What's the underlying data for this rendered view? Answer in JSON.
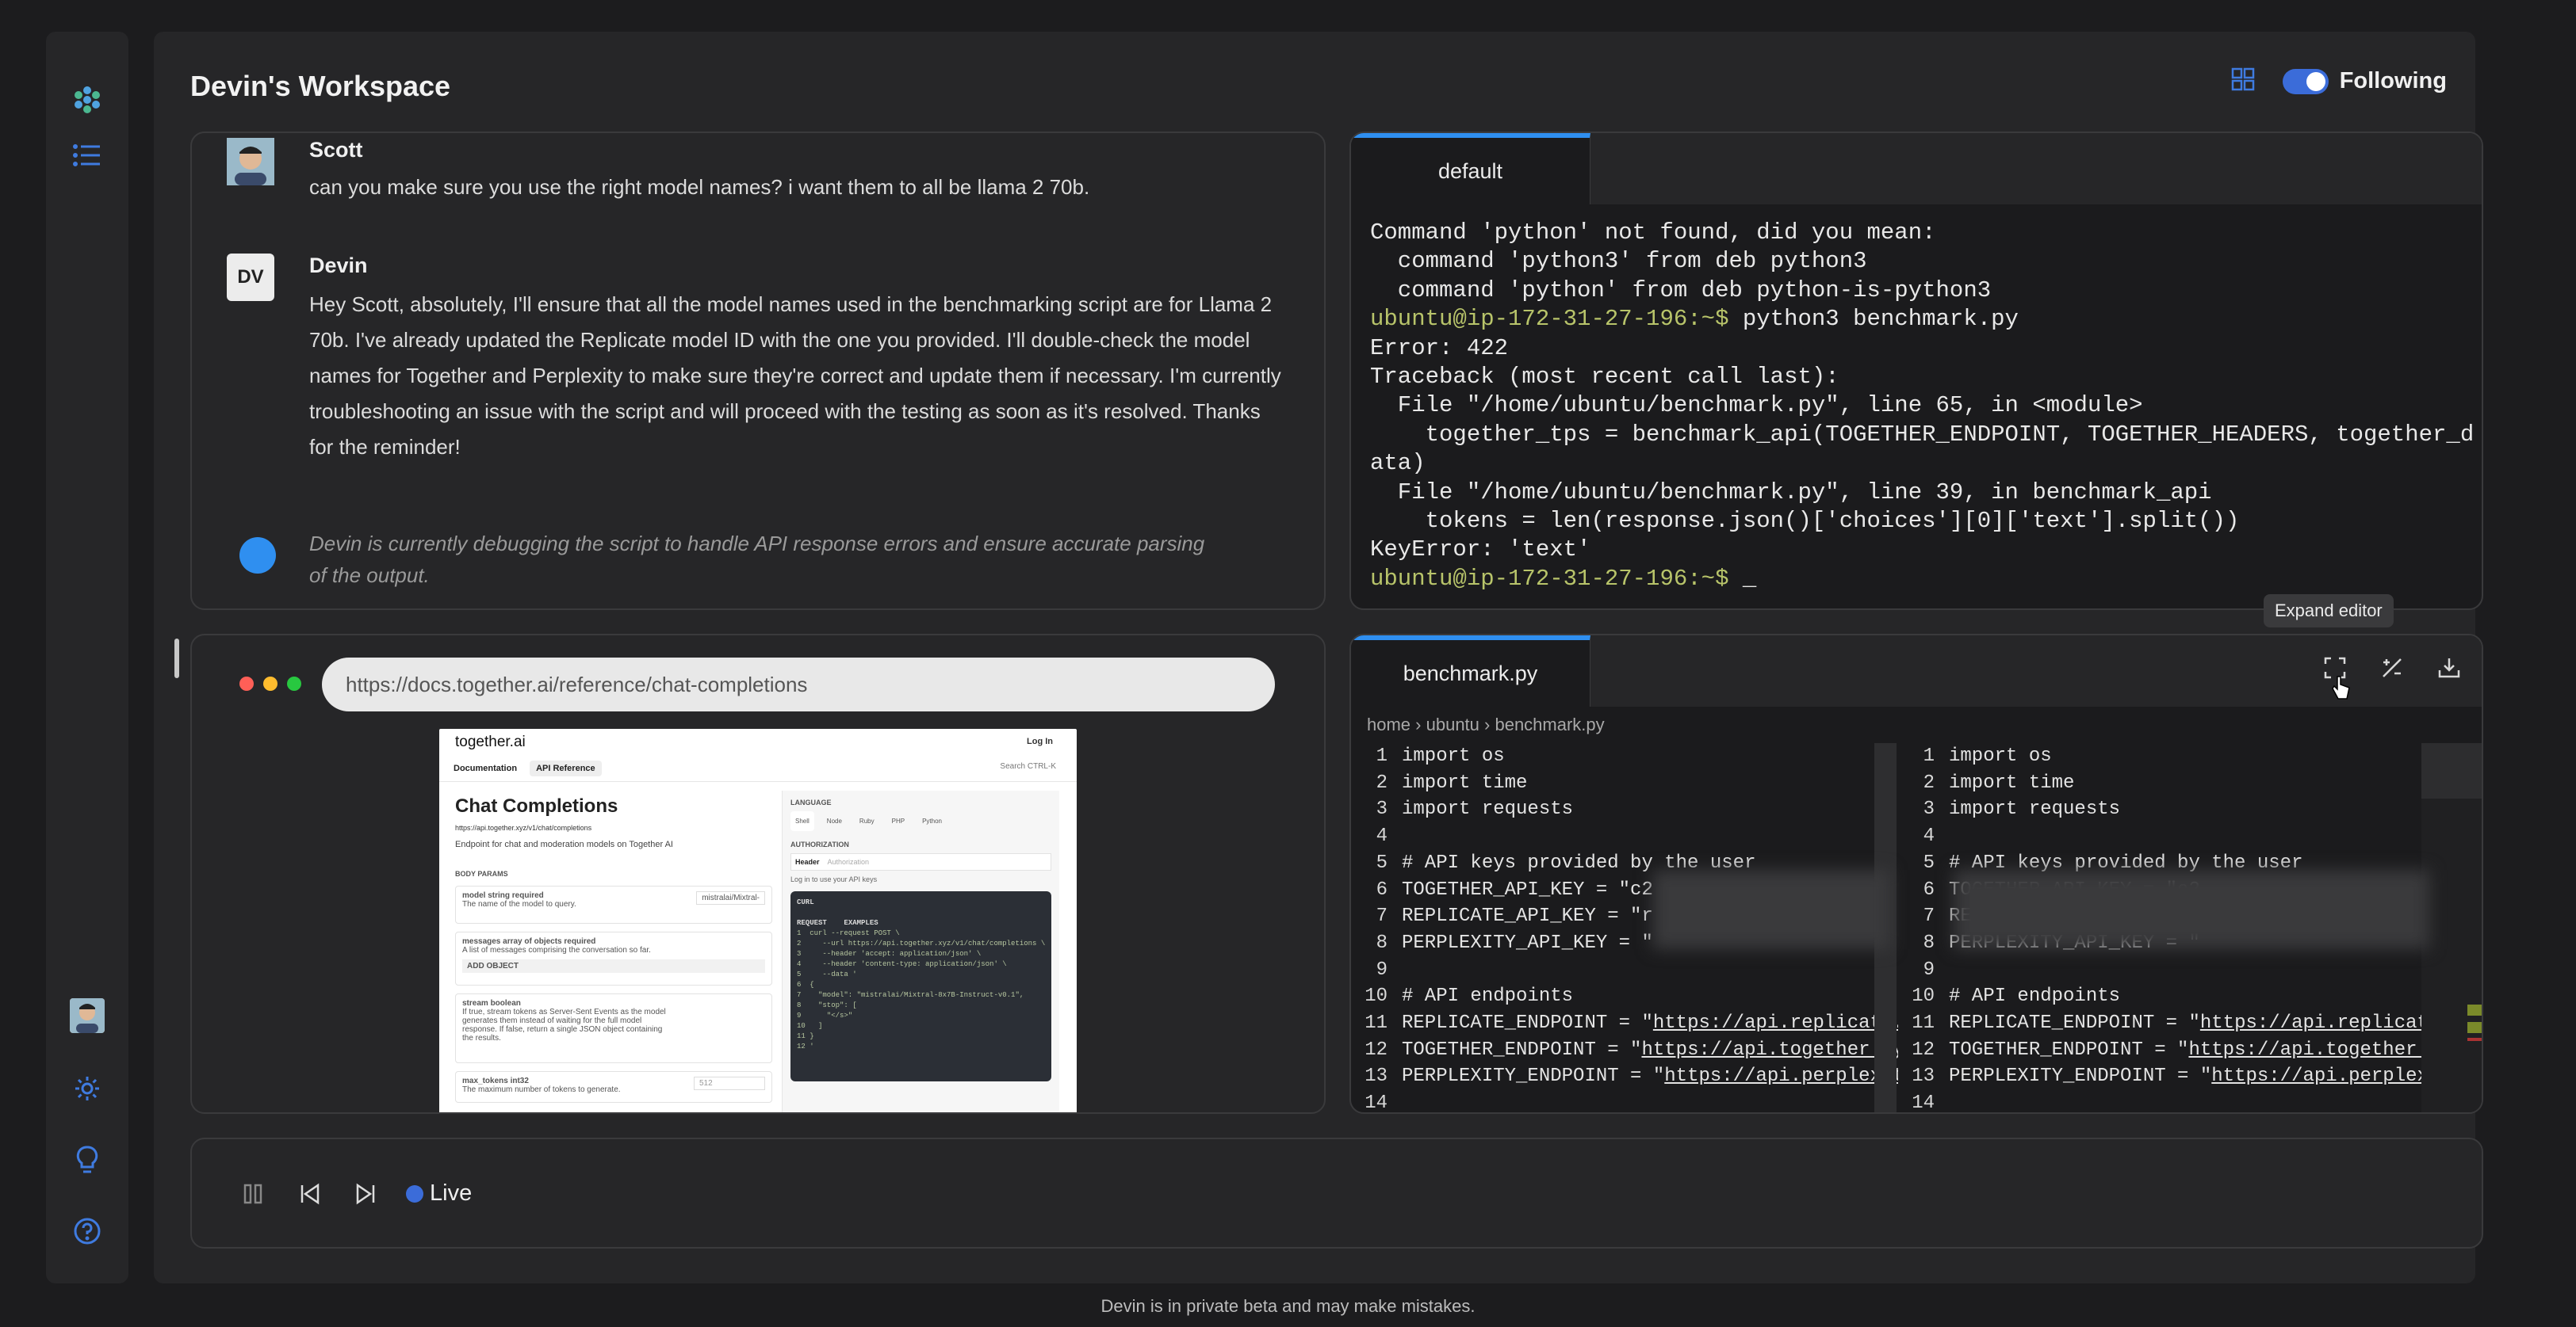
{
  "workspace": {
    "title": "Devin's Workspace",
    "following_label": "Following"
  },
  "chat": {
    "messages": [
      {
        "name": "Scott",
        "text": "can you make sure you use the right model names? i want them to all be llama 2 70b."
      },
      {
        "name": "Devin",
        "initials": "DV",
        "text": "Hey Scott, absolutely, I'll ensure that all the model names used in the benchmarking script are for Llama 2 70b. I've already updated the Replicate model ID with the one you provided. I'll double-check the model names for Together and Perplexity to make sure they're correct and update them if necessary. I'm currently troubleshooting an issue with the script and will proceed with the testing as soon as it's resolved. Thanks for the reminder!"
      }
    ],
    "status": "Devin is currently debugging the script to handle API response errors and ensure accurate parsing of the output."
  },
  "terminal": {
    "tab": "default",
    "lines": [
      "Command 'python' not found, did you mean:",
      "  command 'python3' from deb python3",
      "  command 'python' from deb python-is-python3",
      "Error: 422",
      "Traceback (most recent call last):",
      "  File \"/home/ubuntu/benchmark.py\", line 65, in <module>",
      "    together_tps = benchmark_api(TOGETHER_ENDPOINT, TOGETHER_HEADERS, together_d",
      "ata)",
      "  File \"/home/ubuntu/benchmark.py\", line 39, in benchmark_api",
      "    tokens = len(response.json()['choices'][0]['text'].split())",
      "KeyError: 'text'"
    ],
    "prompt": "ubuntu@ip-172-31-27-196:~$",
    "command": " python3 benchmark.py",
    "cursor": " _"
  },
  "browser": {
    "url": "https://docs.together.ai/reference/chat-completions",
    "page": {
      "logo": "together.ai",
      "login": "Log In",
      "nav_docs": "Documentation",
      "nav_api": "API Reference",
      "search": "Search   CTRL-K",
      "title": "Chat Completions",
      "endpoint": "https://api.together.xyz/v1/chat/completions",
      "description": "Endpoint for chat and moderation models on Together AI",
      "body_params": "BODY PARAMS",
      "param_model": "model  string  required",
      "param_model_desc": "The name of the model to query.",
      "param_model_value": "mistralai/Mixtral-",
      "param_messages": "messages  array of objects  required",
      "param_messages_desc": "A list of messages comprising the conversation so far.",
      "add_object": "ADD OBJECT",
      "param_stream": "stream  boolean",
      "param_stream_desc": "If true, stream tokens as Server-Sent Events as the model generates them instead of waiting for the full model response. If false, return a single JSON object containing the results.",
      "param_max_tokens": "max_tokens  int32",
      "param_max_tokens_desc": "The maximum number of tokens to generate.",
      "param_max_tokens_value": "512",
      "language": "LANGUAGE",
      "languages": [
        "Shell",
        "Node",
        "Ruby",
        "PHP",
        "Python"
      ],
      "authorization": "AUTHORIZATION",
      "header_label": "Header",
      "header_placeholder": "Authorization",
      "login_note": "Log in to use your API keys",
      "curl": "CURL",
      "request": "REQUEST",
      "examples": "EXAMPLES",
      "code": "1  curl --request POST \\\n2     --url https://api.together.xyz/v1/chat/completions \\\n3     --header 'accept: application/json' \\\n4     --header 'content-type: application/json' \\\n5     --data '\n6  {\n7    \"model\": \"mistralai/Mixtral-8x7B-Instruct-v0.1\",\n8    \"stop\": [\n9      \"</s>\"\n10   ]\n11 }\n12 '"
    }
  },
  "editor": {
    "tab": "benchmark.py",
    "breadcrumb": [
      "home",
      "ubuntu",
      "benchmark.py"
    ],
    "tooltip": "Expand editor",
    "lines": [
      {
        "n": "1",
        "code": "import os"
      },
      {
        "n": "2",
        "code": "import time"
      },
      {
        "n": "3",
        "code": "import requests"
      },
      {
        "n": "4",
        "code": ""
      },
      {
        "n": "5",
        "code": "# API keys provided by the user"
      },
      {
        "n": "6",
        "code": "TOGETHER_API_KEY = \"c2"
      },
      {
        "n": "7",
        "code": "REPLICATE_API_KEY = \"r"
      },
      {
        "n": "8",
        "code": "PERPLEXITY_API_KEY = \""
      },
      {
        "n": "9",
        "code": ""
      },
      {
        "n": "10",
        "code": "# API endpoints"
      },
      {
        "n": "11",
        "code": "REPLICATE_ENDPOINT = \"",
        "url": "https://api.replicate.c"
      },
      {
        "n": "12",
        "code": "TOGETHER_ENDPOINT = \"",
        "url": "https://api.together.xyz"
      },
      {
        "n": "13",
        "code": "PERPLEXITY_ENDPOINT = \"",
        "url": "https://api.perplexity"
      },
      {
        "n": "14",
        "code": ""
      }
    ]
  },
  "player": {
    "live_label": "Live"
  },
  "footer": "Devin is in private beta and may make mistakes.",
  "colors": {
    "accent": "#2f8ff0",
    "toggle": "#3b6cd9",
    "prompt": "#b8c46a",
    "background": "#1c1c1e",
    "panel": "#262628"
  },
  "icons": [
    "logo-icon",
    "list-icon",
    "gear-icon",
    "lightbulb-icon",
    "help-icon",
    "grid-icon",
    "expand-icon",
    "diff-icon",
    "download-icon",
    "pause-icon",
    "skip-back-icon",
    "skip-forward-icon"
  ]
}
